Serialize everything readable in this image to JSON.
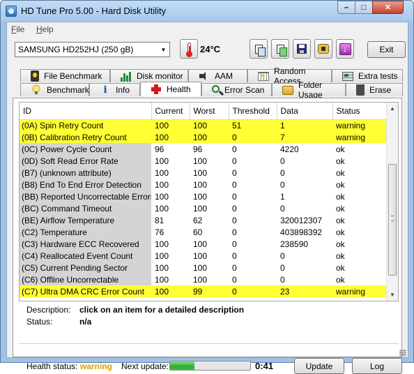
{
  "window": {
    "title": "HD Tune Pro 5.00 - Hard Disk Utility"
  },
  "menu": [
    {
      "accel": "F",
      "rest": "ile"
    },
    {
      "accel": "H",
      "rest": "elp"
    }
  ],
  "toolbar": {
    "drive": "SAMSUNG HD252HJ (250 gB)",
    "temperature": "24°C",
    "exit_label": "Exit"
  },
  "tabs_top": [
    {
      "label": "File Benchmark",
      "icon": "file-benchmark-icon"
    },
    {
      "label": "Disk monitor",
      "icon": "disk-monitor-icon"
    },
    {
      "label": "AAM",
      "icon": "speaker-icon"
    },
    {
      "label": "Random Access",
      "icon": "random-access-icon"
    },
    {
      "label": "Extra tests",
      "icon": "extra-tests-icon"
    }
  ],
  "tabs_bottom": [
    {
      "label": "Benchmark",
      "icon": "lightbulb-icon"
    },
    {
      "label": "Info",
      "icon": "info-icon"
    },
    {
      "label": "Health",
      "icon": "red-cross-icon",
      "active": true
    },
    {
      "label": "Error Scan",
      "icon": "magnifier-icon"
    },
    {
      "label": "Folder Usage",
      "icon": "folder-icon"
    },
    {
      "label": "Erase",
      "icon": "trash-icon"
    }
  ],
  "table": {
    "columns": [
      "ID",
      "Current",
      "Worst",
      "Threshold",
      "Data",
      "Status"
    ],
    "rows": [
      {
        "id": "(0A) Spin Retry Count",
        "current": "100",
        "worst": "100",
        "threshold": "51",
        "data": "1",
        "status": "warning",
        "highlight": true
      },
      {
        "id": "(0B) Calibration Retry Count",
        "current": "100",
        "worst": "100",
        "threshold": "0",
        "data": "7",
        "status": "warning",
        "highlight": true
      },
      {
        "id": "(0C) Power Cycle Count",
        "current": "96",
        "worst": "96",
        "threshold": "0",
        "data": "4220",
        "status": "ok",
        "highlight": false
      },
      {
        "id": "(0D) Soft Read Error Rate",
        "current": "100",
        "worst": "100",
        "threshold": "0",
        "data": "0",
        "status": "ok",
        "highlight": false
      },
      {
        "id": "(B7) (unknown attribute)",
        "current": "100",
        "worst": "100",
        "threshold": "0",
        "data": "0",
        "status": "ok",
        "highlight": false
      },
      {
        "id": "(B8) End To End Error Detection",
        "current": "100",
        "worst": "100",
        "threshold": "0",
        "data": "0",
        "status": "ok",
        "highlight": false
      },
      {
        "id": "(BB) Reported Uncorrectable Errors",
        "current": "100",
        "worst": "100",
        "threshold": "0",
        "data": "1",
        "status": "ok",
        "highlight": false
      },
      {
        "id": "(BC) Command Timeout",
        "current": "100",
        "worst": "100",
        "threshold": "0",
        "data": "0",
        "status": "ok",
        "highlight": false
      },
      {
        "id": "(BE) Airflow Temperature",
        "current": "81",
        "worst": "62",
        "threshold": "0",
        "data": "320012307",
        "status": "ok",
        "highlight": false
      },
      {
        "id": "(C2) Temperature",
        "current": "76",
        "worst": "60",
        "threshold": "0",
        "data": "403898392",
        "status": "ok",
        "highlight": false
      },
      {
        "id": "(C3) Hardware ECC Recovered",
        "current": "100",
        "worst": "100",
        "threshold": "0",
        "data": "238590",
        "status": "ok",
        "highlight": false
      },
      {
        "id": "(C4) Reallocated Event Count",
        "current": "100",
        "worst": "100",
        "threshold": "0",
        "data": "0",
        "status": "ok",
        "highlight": false
      },
      {
        "id": "(C5) Current Pending Sector",
        "current": "100",
        "worst": "100",
        "threshold": "0",
        "data": "0",
        "status": "ok",
        "highlight": false
      },
      {
        "id": "(C6) Offline Uncorrectable",
        "current": "100",
        "worst": "100",
        "threshold": "0",
        "data": "0",
        "status": "ok",
        "highlight": false
      },
      {
        "id": "(C7) Ultra DMA CRC Error Count",
        "current": "100",
        "worst": "99",
        "threshold": "0",
        "data": "23",
        "status": "warning",
        "highlight": true
      }
    ]
  },
  "details": {
    "description_label": "Description:",
    "description_value": "click on an item for a detailed description",
    "status_label": "Status:",
    "status_value": "n/a"
  },
  "footer": {
    "health_label": "Health status:",
    "health_value": "warning",
    "next_update_label": "Next update:",
    "next_update_progress": 0.3,
    "countdown": "0:41",
    "update_label": "Update",
    "log_label": "Log"
  },
  "colors": {
    "warning_row": "#ffff33",
    "warning_text": "#d8a000",
    "progress": "#2fae2f"
  }
}
